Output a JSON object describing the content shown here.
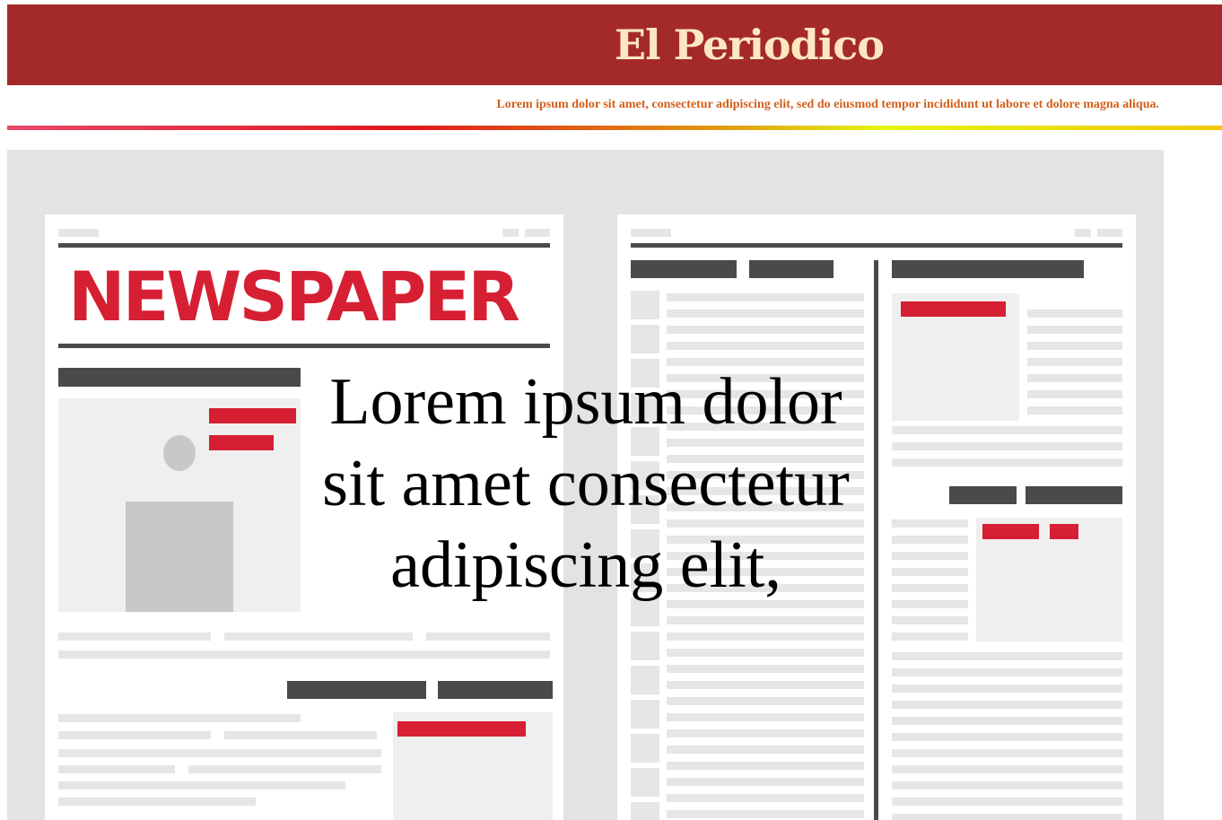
{
  "header": {
    "title": "El Periodico",
    "subtitle": "Lorem ipsum dolor sit amet, consectetur adipiscing elit, sed do eiusmod tempor incididunt ut labore et dolore magna aliqua.",
    "background": "#a42a2a",
    "title_color": "#fde7c0",
    "subtitle_color": "#d2601a"
  },
  "hero": {
    "illustration_heading": "NEWSPAPER",
    "overlay_text": "Lorem ipsum dolor sit amet consectetur adipiscing elit,"
  }
}
